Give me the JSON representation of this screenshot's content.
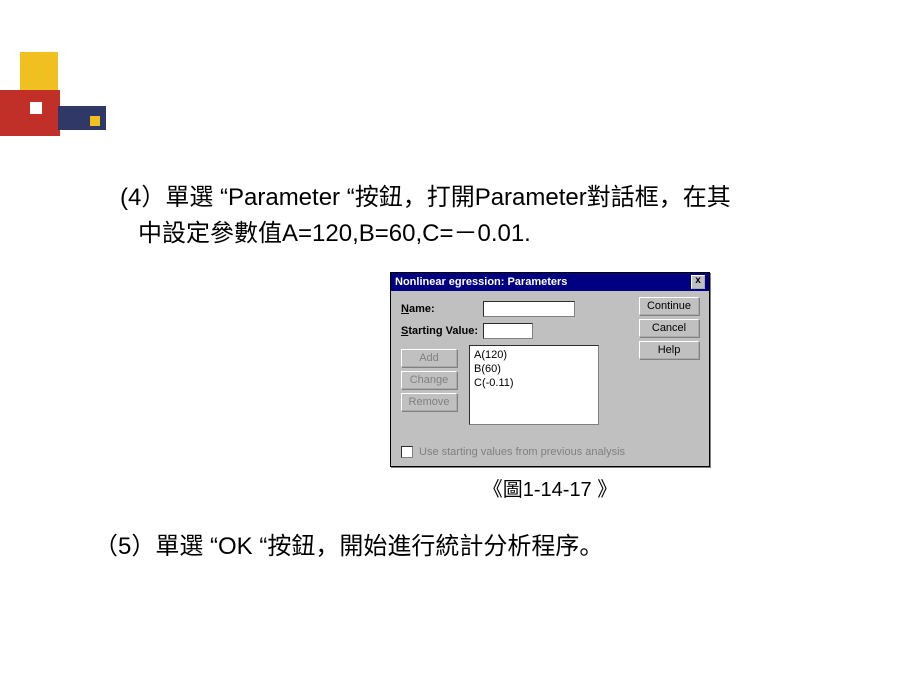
{
  "para4_line1": "(4）單選 “Parameter “按鈕，打開Parameter對話框，在其",
  "para4_line2": "中設定參數值A=120,B=60,C=－0.01.",
  "dialog": {
    "title": "Nonlinear    egression: Parameters",
    "close_glyph": "x",
    "name_label_pre": "N",
    "name_label_post": "ame:",
    "sv_label_pre": "S",
    "sv_label_post": "tarting Value:",
    "btn_add_pre": "A",
    "btn_add_post": "dd",
    "btn_change_pre": "C",
    "btn_change_post": "hange",
    "btn_remove_pre": "R",
    "btn_remove_post": "emove",
    "btn_continue": "Continue",
    "btn_cancel": "Cancel",
    "btn_help": "Help",
    "list": {
      "item0": "A(120)",
      "item1": "B(60)",
      "item2": "C(-0.11)"
    },
    "checkbox_label": "Use starting values from previous analysis"
  },
  "caption": "《圖1-14-17  》",
  "para5": "（5）單選 “OK “按鈕，開始進行統計分析程序。"
}
